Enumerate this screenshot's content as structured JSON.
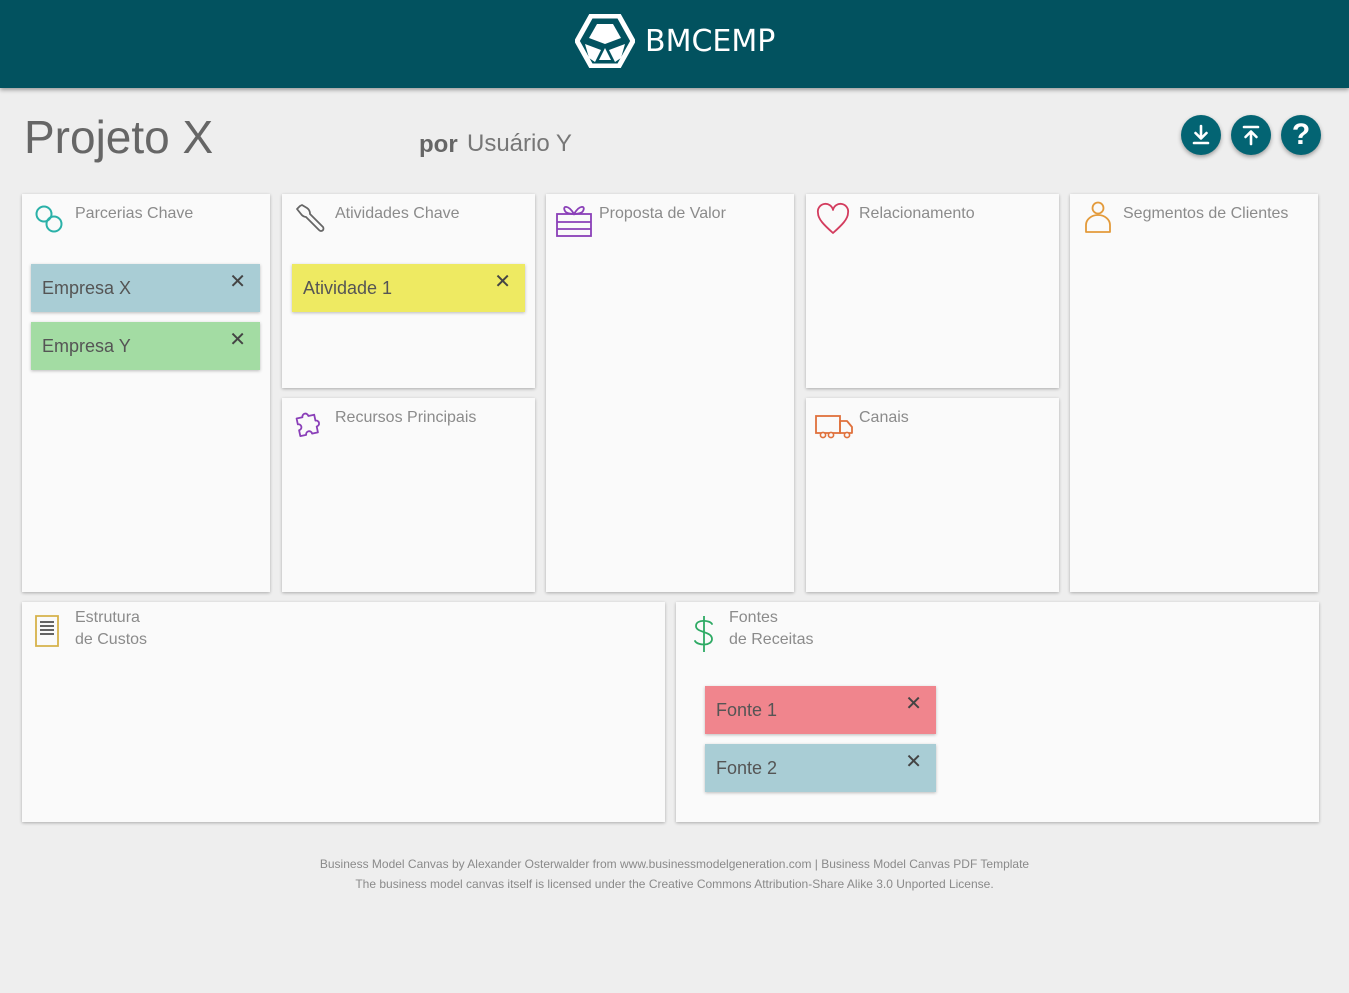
{
  "brand": {
    "name": "BMCEMP",
    "header_color": "#02525f"
  },
  "project": {
    "title": "Projeto X",
    "by_label": "por",
    "user": "Usuário Y"
  },
  "actions": {
    "download_icon": "download-icon",
    "upload_icon": "upload-icon",
    "help_label": "?"
  },
  "blocks": {
    "key_partners": {
      "title": "Parcerias Chave",
      "icon": "link-icon",
      "notes": [
        {
          "label": "Empresa X",
          "color": "#a9cdd5"
        },
        {
          "label": "Empresa Y",
          "color": "#a3dca3"
        }
      ]
    },
    "key_activities": {
      "title": "Atividades Chave",
      "icon": "wrench-icon",
      "notes": [
        {
          "label": "Atividade 1",
          "color": "#eeea62"
        }
      ]
    },
    "key_resources": {
      "title": "Recursos Principais",
      "icon": "puzzle-icon"
    },
    "value_proposition": {
      "title": "Proposta de Valor",
      "icon": "gift-icon"
    },
    "relationships": {
      "title": "Relacionamento",
      "icon": "heart-icon"
    },
    "channels": {
      "title": "Canais",
      "icon": "truck-icon"
    },
    "segments": {
      "title": "Segmentos de Clientes",
      "icon": "person-icon"
    },
    "cost_structure": {
      "title_line1": "Estrutura",
      "title_line2": "de Custos",
      "icon": "document-icon"
    },
    "revenue_streams": {
      "title_line1": "Fontes",
      "title_line2": "de Receitas",
      "icon": "dollar-icon",
      "notes": [
        {
          "label": "Fonte 1",
          "color": "#f0858d"
        },
        {
          "label": "Fonte 2",
          "color": "#a9cdd5"
        }
      ]
    }
  },
  "note_close": "✕",
  "footer": {
    "line1": "Business Model Canvas by Alexander Osterwalder from www.businessmodelgeneration.com | Business Model Canvas PDF Template",
    "line2": "The business model canvas itself is licensed under the Creative Commons Attribution-Share Alike 3.0 Unported License."
  }
}
